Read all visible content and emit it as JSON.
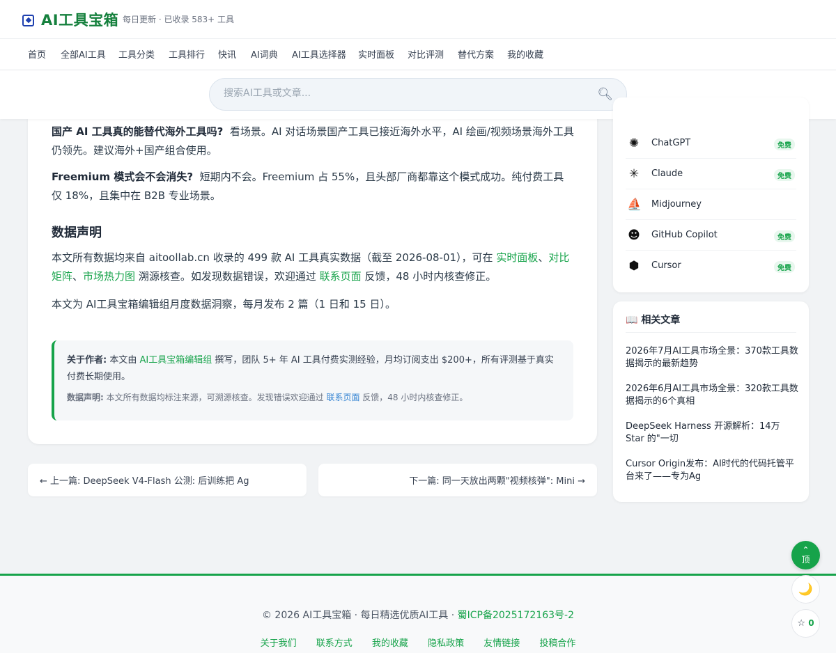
{
  "header": {
    "logo": "AI工具宝箱",
    "tagline": "每日更新 · 已收录 583+ 工具"
  },
  "nav": [
    "首页",
    "全部AI工具",
    "工具分类",
    "工具排行",
    "快讯",
    "AI词典",
    "AI工具选择器",
    "实时面板",
    "对比评测",
    "替代方案",
    "我的收藏"
  ],
  "search": {
    "placeholder": "搜索AI工具或文章..."
  },
  "article": {
    "qa1_q": "国产 AI 工具真的能替代海外工具吗?",
    "qa1_a": "看场景。AI 对话场景国产工具已接近海外水平，AI 绘画/视频场景海外工具仍领先。建议海外+国产组合使用。",
    "qa2_q": "Freemium 模式会不会消失?",
    "qa2_a": "短期内不会。Freemium 占 55%，且头部厂商都靠这个模式成功。纯付费工具仅 18%，且集中在 B2B 专业场景。",
    "h2": "数据声明",
    "p1_a": "本文所有数据均来自 aitoollab.cn 收录的 499 款 AI 工具真实数据（截至 2026-08-01），可在 ",
    "p1_link1": "实时面板",
    "p1_sep1": "、",
    "p1_link2": "对比矩阵",
    "p1_sep2": "、",
    "p1_link3": "市场热力图",
    "p1_b": " 溯源核查。如发现数据错误，欢迎通过 ",
    "p1_link4": "联系页面",
    "p1_c": " 反馈，48 小时内核查修正。",
    "p2": "本文为 AI工具宝箱编辑组月度数据洞察，每月发布 2 篇（1 日和 15 日）。",
    "author_label": "关于作者:",
    "author_a": " 本文由 ",
    "author_link": "AI工具宝箱编辑组",
    "author_b": " 撰写，团队 5+ 年 AI 工具付费实测经验，月均订阅支出 $200+，所有评测基于真实付费长期使用。",
    "note_label": "数据声明:",
    "note_a": " 本文所有数据均标注来源，可溯源核查。发现错误欢迎通过 ",
    "note_link": "联系页面",
    "note_b": " 反馈，48 小时内核查修正。"
  },
  "pagination": {
    "prev": "← 上一篇: DeepSeek V4-Flash 公测: 后训练把 Ag",
    "next": "下一篇: 同一天放出两颗\"视频核弹\": Mini →"
  },
  "tools": [
    {
      "name": "ChatGPT",
      "badge": "免费",
      "icon": "chatgpt-icon"
    },
    {
      "name": "Claude",
      "badge": "免费",
      "icon": "claude-icon"
    },
    {
      "name": "Midjourney",
      "badge": "",
      "icon": "midjourney-icon"
    },
    {
      "name": "GitHub Copilot",
      "badge": "免费",
      "icon": "github-copilot-icon"
    },
    {
      "name": "Cursor",
      "badge": "免费",
      "icon": "cursor-icon"
    }
  ],
  "related": {
    "title": "相关文章",
    "items": [
      "2026年7月AI工具市场全景：370款工具数据揭示的最新趋势",
      "2026年6月AI工具市场全景：320款工具数据揭示的6个真相",
      "DeepSeek Harness 开源解析：14万 Star 的\"一切",
      "Cursor Origin发布：AI时代的代码托管平台来了——专为Ag"
    ]
  },
  "footer": {
    "copy": "© 2026 AI工具宝箱 · 每日精选优质AI工具 · ",
    "icp": "蜀ICP备2025172163号-2",
    "links": [
      "关于我们",
      "联系方式",
      "我的收藏",
      "隐私政策",
      "友情链接",
      "投稿合作"
    ]
  },
  "fab": {
    "top_arrow": "⌃",
    "top_label": "顶",
    "dark_icon": "🌙",
    "fav_icon": "☆",
    "fav_count": "0"
  },
  "colors": {
    "accent": "#16a34a",
    "logo": "#15803d"
  }
}
